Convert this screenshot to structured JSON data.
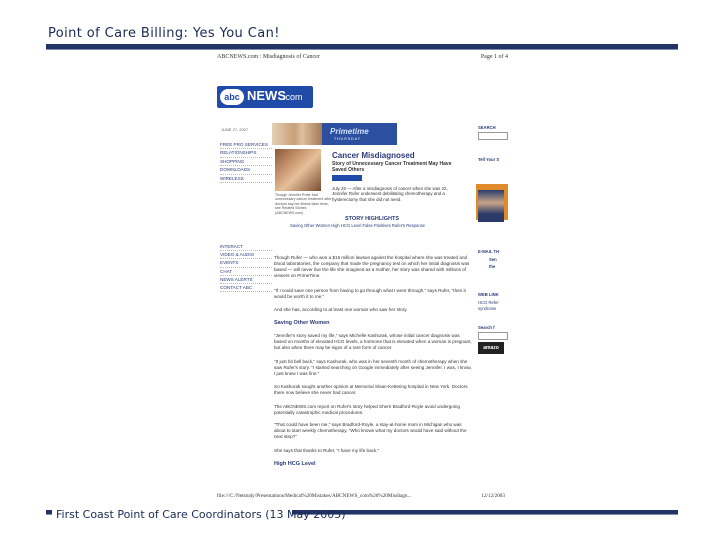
{
  "slide": {
    "title": "Point of Care Billing:  Yes You Can!",
    "footer": "First Coast Point of Care Coordinators (13 May 2005)"
  },
  "document": {
    "header_left": "ABCNEWS.com : Misdiagnosis of Cancer",
    "header_right": "Page 1 of 4",
    "logo_abc": "abc",
    "logo_news": "NEWS",
    "logo_dotcom": ".com",
    "date_small": "JUNE 27, 2007",
    "nav_top": [
      "FREE PRO SERVICES",
      "RELATIONSHIPS",
      "SHOPPING",
      "DOWNLOADS",
      "WIRELESS"
    ],
    "nav_bottom": [
      "INTERACT",
      "VIDEO & AUDIO",
      "EVENTS",
      "CHAT",
      "NEWS ALERTS",
      "CONTACT ABC"
    ],
    "banner_word": "Primetime",
    "banner_sub": "THURSDAY",
    "caption": "Though Jennifer Rufer had unnecessary cancer treatment after doctors say her illness false tests, see Related Stories (ABCNEWS.com)",
    "story_title": "Cancer Misdiagnosed",
    "story_deck": "Story of Unnecessary Cancer Treatment May Have Saved Others",
    "story_lead": "July 26 — After a misdiagnosis of cancer when she was 22, Jennifer Rufer underwent debilitating chemotherapy and a hysterectomy that she did not need.",
    "highlights_title": "STORY HIGHLIGHTS",
    "highlight_links": "Saving Other Women   High HCG Level   False Positives   Rufer's Response",
    "body_1": "Though Rufer — who won a $16 million lawsuit against the hospital where she was treated and blood laboratories, the company that made the pregnancy test on which her initial diagnosis was based — will never live the life she imagined as a mother, her story was shared with millions of viewers on PrimeTime.",
    "body_2": "\"If I could save one person from having to go through what I went through,\" says Rufer, \"then it would be worth it to me.\"",
    "body_3": "And she has, according to at least one woman who saw her story.",
    "section_saving": "Saving Other Women",
    "body_4": "\"Jennifer's story saved my life,\" says Michelle Kashurak, whose initial cancer diagnosis was based on months of elevated HCG levels, a hormone that is elevated when a woman is pregnant, but also when there may be signs of a rare form of cancer.",
    "body_5": "\"It just hit bell back,\" says Kashurak, who was in her seventh month of chemotherapy when she saw Rufer's story. \"I started searching on Google immediately after seeing Jennifer. I was, I know, I just knew I was fine.\"",
    "body_6": "So Kashurak sought another opinion at Memorial Sloan-Kettering hospital in New York. Doctors there now believe she never had cancer.",
    "body_7": "The ABCNEWS.com report on Rufer's story helped Sherri Bradford-Royle avoid undergoing potentially catastrophic medical procedures.",
    "body_8": "\"That could have been me,\" says Bradford-Royle, a stay-at-home mom in Michigan who was about to start weekly chemotherapy. \"Who knows what my doctors would have said without the next step?\"",
    "body_9": "She says that thanks to Rufer, \"I have my life back.\"",
    "section_hcg": "High HCG Level",
    "side_search": "SEARCH",
    "side_abcnews": "ABCNEWS",
    "side_tell": "Tell Your S",
    "side_email": "E-MAIL TH",
    "side_sen": "Sen",
    "side_the": "the",
    "side_web": "WEB LINK",
    "side_hcg": "HCG Refer",
    "side_syndrome": "syndrome",
    "side_search2": "Search f",
    "side_amazon": "amazo",
    "footer_left": "file:///C:/Netstudy/Presentations/Medical%20Mistakes/ABCNEWS_com%20%20Misdiagn...",
    "footer_right": "12/12/2003"
  }
}
